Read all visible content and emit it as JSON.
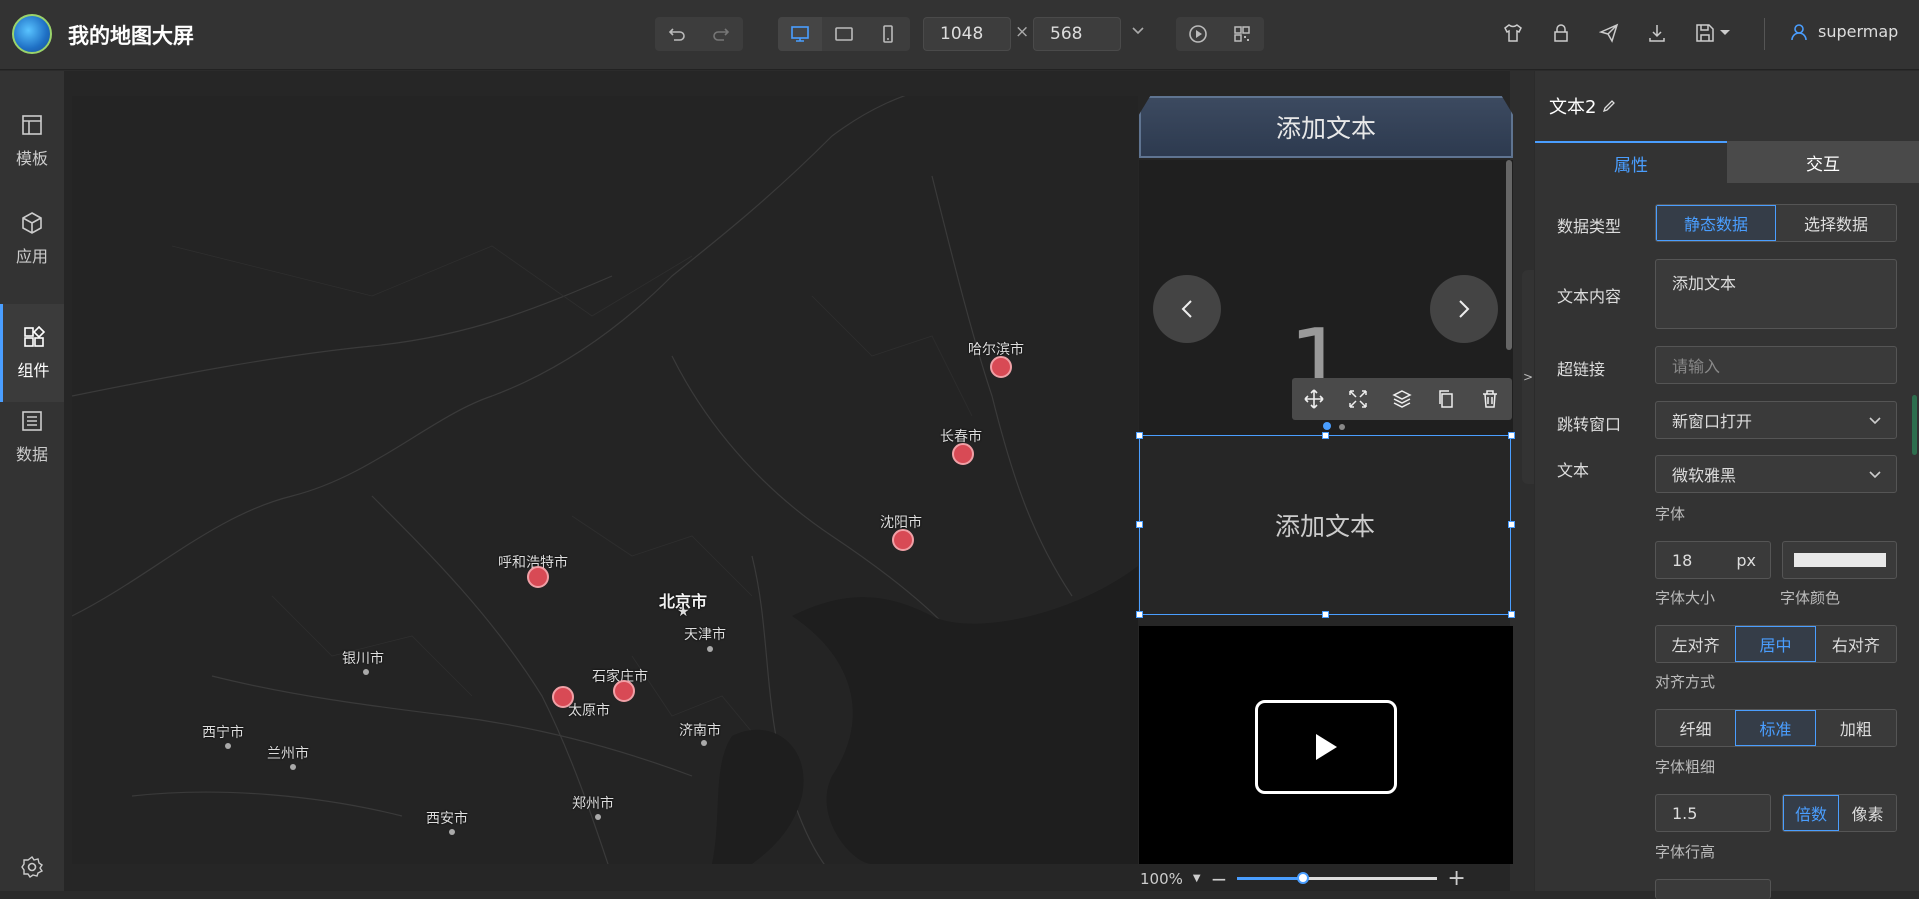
{
  "app": {
    "title": "我的地图大屏"
  },
  "toolbar": {
    "width_value": "1048",
    "height_value": "568",
    "times": "×"
  },
  "user": {
    "name": "supermap"
  },
  "sidebar": {
    "items": [
      {
        "label": "模板",
        "icon": "template-icon"
      },
      {
        "label": "应用",
        "icon": "cube-icon"
      },
      {
        "label": "组件",
        "icon": "components-icon"
      },
      {
        "label": "数据",
        "icon": "data-list-icon"
      }
    ]
  },
  "map": {
    "cities": [
      {
        "name": "哈尔滨市",
        "marker": true
      },
      {
        "name": "长春市",
        "marker": true
      },
      {
        "name": "沈阳市",
        "marker": true
      },
      {
        "name": "呼和浩特市",
        "marker": true
      },
      {
        "name": "北京市",
        "capital": true
      },
      {
        "name": "天津市"
      },
      {
        "name": "银川市"
      },
      {
        "name": "石家庄市",
        "marker": true
      },
      {
        "name": "太原市",
        "marker": true
      },
      {
        "name": "济南市"
      },
      {
        "name": "西宁市"
      },
      {
        "name": "兰州市"
      },
      {
        "name": "郑州市"
      },
      {
        "name": "西安市"
      }
    ]
  },
  "canvas": {
    "title_component": "添加文本",
    "carousel_number": "1",
    "selected_text": "添加文本",
    "zoom": "100%",
    "zoom_fraction": 0.33
  },
  "panel": {
    "title": "文本2",
    "tabs": [
      "属性",
      "交互"
    ],
    "data_type_label": "数据类型",
    "data_type_options": [
      "静态数据",
      "选择数据"
    ],
    "text_content_label": "文本内容",
    "text_content_value": "添加文本",
    "hyperlink_label": "超链接",
    "hyperlink_placeholder": "请输入",
    "jump_label": "跳转窗口",
    "jump_value": "新窗口打开",
    "text_label": "文本",
    "font_value": "微软雅黑",
    "font_label": "字体",
    "font_size_value": "18",
    "font_size_unit": "px",
    "font_size_label": "字体大小",
    "font_color_label": "字体颜色",
    "align_options": [
      "左对齐",
      "居中",
      "右对齐"
    ],
    "align_label": "对齐方式",
    "weight_options": [
      "纤细",
      "标准",
      "加粗"
    ],
    "weight_label": "字体粗细",
    "line_height_value": "1.5",
    "line_height_modes": [
      "倍数",
      "像素"
    ],
    "line_height_label": "字体行高"
  },
  "colors": {
    "accent": "#4a9eff",
    "marker": "#d84a55"
  }
}
